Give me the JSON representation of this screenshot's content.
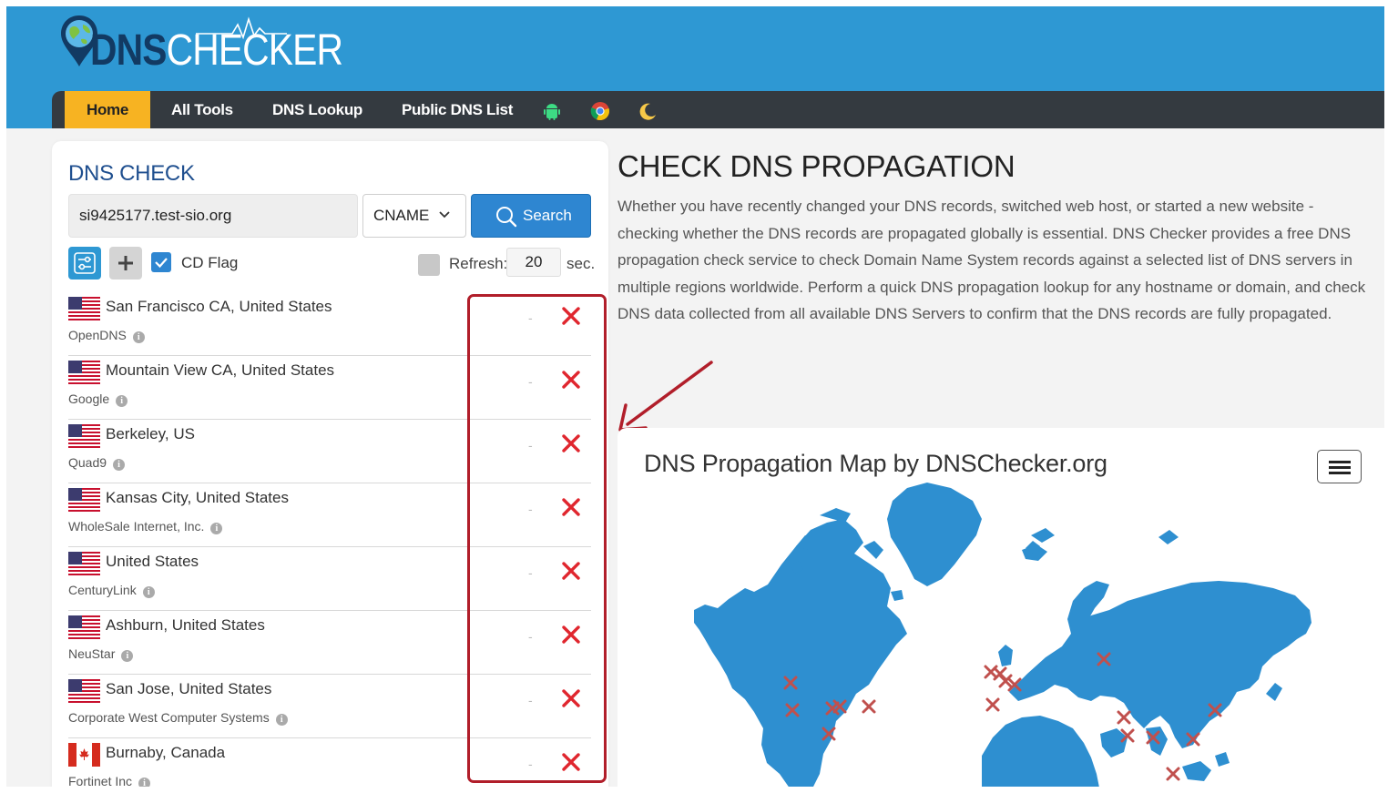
{
  "brand": {
    "logo_dns": "DNS",
    "logo_checker": "CHECKER"
  },
  "nav": {
    "items": [
      {
        "label": "Home",
        "active": true
      },
      {
        "label": "All Tools"
      },
      {
        "label": "DNS Lookup"
      },
      {
        "label": "Public DNS List"
      }
    ],
    "icons": [
      "android-icon",
      "chrome-icon",
      "moon-icon"
    ]
  },
  "dns_check": {
    "title": "DNS CHECK",
    "domain_value": "si9425177.test-sio.org",
    "record_type": "CNAME",
    "search_label": "Search",
    "cd_flag_label": "CD Flag",
    "cd_flag_checked": true,
    "refresh_label": "Refresh:",
    "refresh_value": "20",
    "refresh_unit": "sec."
  },
  "servers": [
    {
      "location": "San Francisco CA, United States",
      "provider": "OpenDNS",
      "flag": "us",
      "result": "-",
      "status": "fail"
    },
    {
      "location": "Mountain View CA, United States",
      "provider": "Google",
      "flag": "us",
      "result": "-",
      "status": "fail"
    },
    {
      "location": "Berkeley, US",
      "provider": "Quad9",
      "flag": "us",
      "result": "-",
      "status": "fail"
    },
    {
      "location": "Kansas City, United States",
      "provider": "WholeSale Internet, Inc.",
      "flag": "us",
      "result": "-",
      "status": "fail"
    },
    {
      "location": "United States",
      "provider": "CenturyLink",
      "flag": "us",
      "result": "-",
      "status": "fail"
    },
    {
      "location": "Ashburn, United States",
      "provider": "NeuStar",
      "flag": "us",
      "result": "-",
      "status": "fail"
    },
    {
      "location": "San Jose, United States",
      "provider": "Corporate West Computer Systems",
      "flag": "us",
      "result": "-",
      "status": "fail"
    },
    {
      "location": "Burnaby, Canada",
      "provider": "Fortinet Inc",
      "flag": "ca",
      "result": "-",
      "status": "fail"
    }
  ],
  "info_glyph": "i",
  "propagation": {
    "title": "CHECK DNS PROPAGATION",
    "description": "Whether you have recently changed your DNS records, switched web host, or started a new website - checking whether the DNS records are propagated globally is essential. DNS Checker provides a free DNS propagation check service to check Domain Name System records against a selected list of DNS servers in multiple regions worldwide. Perform a quick DNS propagation lookup for any hostname or domain, and check DNS data collected from all available DNS Servers to confirm that the DNS records are fully propagated."
  },
  "map": {
    "title": "DNS Propagation Map by DNSChecker.org",
    "land_color": "#2e8fd0",
    "marker_color": "#c0504d"
  },
  "colors": {
    "header": "#2e98d3",
    "navbar": "#343a40",
    "active_tab": "#f7b322",
    "fail": "#e0262e",
    "highlight": "#b11e2a"
  }
}
